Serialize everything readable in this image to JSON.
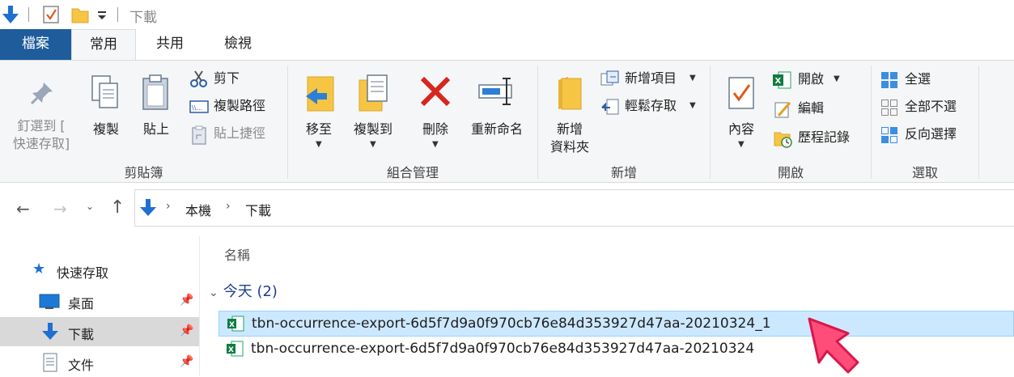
{
  "titlebar": {
    "title": "下載"
  },
  "tabs": [
    {
      "label": "檔案"
    },
    {
      "label": "常用"
    },
    {
      "label": "共用"
    },
    {
      "label": "檢視"
    }
  ],
  "ribbon": {
    "clipboard": {
      "label": "剪貼簿",
      "pin_line1": "釘選到 [",
      "pin_line2": "快速存取]",
      "copy": "複製",
      "paste": "貼上",
      "cut": "剪下",
      "copy_path": "複製路徑",
      "paste_shortcut": "貼上捷徑"
    },
    "organize": {
      "label": "組合管理",
      "move_to": "移至",
      "copy_to": "複製到",
      "delete": "刪除",
      "rename": "重新命名"
    },
    "new": {
      "label": "新增",
      "new_folder_line1": "新增",
      "new_folder_line2": "資料夾",
      "new_item": "新增項目",
      "easy_access": "輕鬆存取"
    },
    "open": {
      "label": "開啟",
      "properties": "內容",
      "open": "開啟",
      "edit": "編輯",
      "history": "歷程記錄"
    },
    "select": {
      "label": "選取",
      "select_all": "全選",
      "select_none": "全部不選",
      "invert": "反向選擇"
    }
  },
  "navbar": {
    "breadcrumb": [
      "本機",
      "下載"
    ]
  },
  "nav_pane": {
    "items": [
      {
        "label": "快速存取"
      },
      {
        "label": "桌面"
      },
      {
        "label": "下載"
      },
      {
        "label": "文件"
      }
    ]
  },
  "content": {
    "column_name": "名稱",
    "group_title": "今天 (2)",
    "files": [
      {
        "name": "tbn-occurrence-export-6d5f7d9a0f970cb76e84d353927d47aa-20210324_1"
      },
      {
        "name": "tbn-occurrence-export-6d5f7d9a0f970cb76e84d353927d47aa-20210324"
      }
    ]
  },
  "colors": {
    "file_tab": "#1e5c9c",
    "selection": "#cce8ff",
    "group_heading": "#1e3f8e",
    "cursor": "#ff3b6b"
  }
}
